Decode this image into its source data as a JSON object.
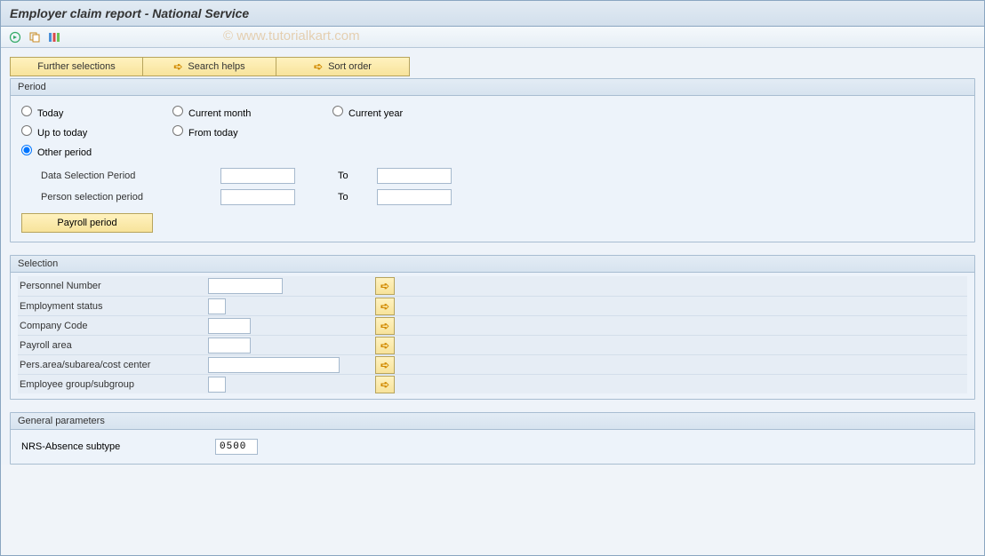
{
  "title": "Employer claim report - National Service",
  "watermark": "© www.tutorialkart.com",
  "topButtons": {
    "further": "Further selections",
    "search": "Search helps",
    "sort": "Sort order"
  },
  "period": {
    "groupTitle": "Period",
    "radios": {
      "today": "Today",
      "currentMonth": "Current month",
      "currentYear": "Current year",
      "upToToday": "Up to today",
      "fromToday": "From today",
      "otherPeriod": "Other period"
    },
    "fields": {
      "dataSelection": "Data Selection Period",
      "personSelection": "Person selection period",
      "to": "To"
    },
    "payrollBtn": "Payroll period"
  },
  "selection": {
    "groupTitle": "Selection",
    "rows": {
      "personnelNumber": "Personnel Number",
      "employmentStatus": "Employment status",
      "companyCode": "Company Code",
      "payrollArea": "Payroll area",
      "persArea": "Pers.area/subarea/cost center",
      "employeeGroup": "Employee group/subgroup"
    }
  },
  "general": {
    "groupTitle": "General parameters",
    "nrsLabel": "NRS-Absence subtype",
    "nrsValue": "0500"
  }
}
